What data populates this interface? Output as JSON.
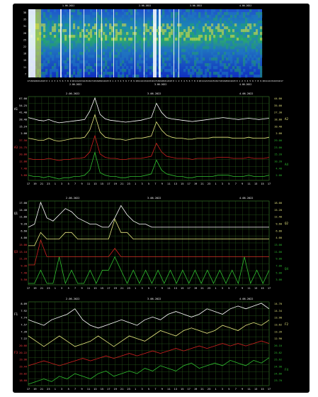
{
  "chart_data": [
    {
      "type": "heatmap",
      "title": "",
      "y_ticks": [
        "38",
        "35",
        "31",
        "28",
        "25",
        "22",
        "18",
        "15",
        "11",
        "7"
      ],
      "top_dates": [
        "1.06.2022",
        "2.06.2022",
        "3.06.2022",
        "4.06.2022"
      ],
      "x_hours": [
        "17",
        "18",
        "19",
        "20",
        "21",
        "22",
        "23",
        "0",
        "1",
        "2",
        "3",
        "4",
        "5",
        "6",
        "7",
        "8",
        "9",
        "10",
        "11",
        "12",
        "13",
        "14",
        "15",
        "16",
        "17",
        "18",
        "19",
        "20",
        "21",
        "22",
        "23",
        "0",
        "1",
        "2",
        "3",
        "4",
        "5",
        "6",
        "7",
        "8",
        "9",
        "10",
        "11",
        "12",
        "13",
        "14",
        "15",
        "16",
        "17",
        "18",
        "19",
        "20",
        "21",
        "22",
        "23",
        "0",
        "1",
        "2",
        "3",
        "4",
        "5",
        "6",
        "7",
        "8",
        "9",
        "10",
        "11",
        "12",
        "13",
        "14",
        "15",
        "16",
        "17",
        "18",
        "19",
        "20",
        "21",
        "22",
        "23",
        "0",
        "1",
        "2",
        "3",
        "4",
        "5",
        "6",
        "7",
        "8",
        "9",
        "10",
        "11",
        "12",
        "13",
        "14",
        "15",
        "16",
        "17"
      ],
      "bottom_dates": [
        "2.06.2022",
        "3.06.2022",
        "4.06.2022"
      ],
      "colors": {
        "low": "#1030c0",
        "mid": "#20a070",
        "high": "#e0e040",
        "peak": "#ffffff"
      }
    },
    {
      "type": "line",
      "panel": "A",
      "series_labels_left": [
        "A1",
        "A3"
      ],
      "series_labels_right": [
        "A2",
        "A4"
      ],
      "left_ticks": [
        "67.00",
        "54.25",
        "41.40",
        "28.40",
        "15.24",
        "2.00",
        "37.50",
        "25.75",
        "20.00",
        "12.00",
        "7.40",
        "3.60"
      ],
      "right_ticks": [
        "44.00",
        "35.00",
        "27.30",
        "18.80",
        "10.40",
        "2.00",
        "29.00",
        "23.00",
        "15.20",
        "10.20",
        "4.40",
        "2.00"
      ],
      "dates": [
        "2.06.2022",
        "3.06.2022",
        "4.06.2022"
      ],
      "x_ticks": [
        "17",
        "19",
        "21",
        "23",
        "1",
        "3",
        "5",
        "7",
        "9",
        "11",
        "13",
        "15",
        "17",
        "19",
        "21",
        "23",
        "1",
        "3",
        "5",
        "7",
        "9",
        "11",
        "13",
        "15",
        "17",
        "19",
        "21",
        "23",
        "1",
        "3",
        "5",
        "7",
        "9",
        "11",
        "13",
        "15",
        "17"
      ],
      "series": [
        {
          "name": "A1",
          "color": "#ffffff",
          "values": [
            30,
            28,
            26,
            25,
            27,
            24,
            22,
            23,
            24,
            25,
            26,
            27,
            40,
            60,
            35,
            28,
            26,
            25,
            24,
            23,
            24,
            25,
            26,
            28,
            30,
            52,
            38,
            30,
            28,
            27,
            26,
            25,
            24,
            25,
            26,
            27,
            28,
            29,
            30,
            29,
            28,
            27,
            28,
            29,
            28,
            27,
            28,
            29
          ]
        },
        {
          "name": "A2",
          "color": "#e8e880",
          "values": [
            22,
            21,
            20,
            20,
            22,
            20,
            19,
            20,
            21,
            22,
            22,
            23,
            30,
            45,
            28,
            23,
            22,
            21,
            21,
            20,
            21,
            22,
            22,
            23,
            24,
            38,
            30,
            25,
            23,
            22,
            22,
            21,
            21,
            22,
            22,
            22,
            23,
            23,
            23,
            23,
            22,
            22,
            22,
            23,
            22,
            22,
            22,
            23
          ]
        },
        {
          "name": "A3",
          "color": "#d02020",
          "values": [
            14,
            13,
            13,
            13,
            14,
            13,
            12,
            13,
            13,
            14,
            14,
            15,
            20,
            35,
            18,
            15,
            14,
            14,
            13,
            13,
            14,
            14,
            14,
            15,
            16,
            28,
            20,
            16,
            15,
            14,
            14,
            14,
            13,
            14,
            14,
            14,
            14,
            15,
            15,
            15,
            14,
            14,
            14,
            15,
            14,
            14,
            14,
            15
          ]
        },
        {
          "name": "A4",
          "color": "#30c030",
          "values": [
            8,
            7,
            7,
            6,
            7,
            6,
            5,
            6,
            6,
            7,
            7,
            8,
            12,
            26,
            10,
            8,
            7,
            7,
            6,
            6,
            7,
            7,
            7,
            8,
            9,
            20,
            12,
            9,
            8,
            7,
            7,
            6,
            6,
            7,
            7,
            7,
            7,
            8,
            8,
            8,
            7,
            7,
            7,
            8,
            7,
            7,
            7,
            8
          ]
        }
      ]
    },
    {
      "type": "line",
      "panel": "Q",
      "series_labels_left": [
        "Q1",
        "Q3"
      ],
      "series_labels_right": [
        "Q2",
        "Q4"
      ],
      "left_ticks": [
        "17.00",
        "14.40",
        "11.80",
        "9.20",
        "6.60",
        "4.00",
        "15.00",
        "13.10",
        "11.20",
        "9.30",
        "7.40",
        "5.50"
      ],
      "right_ticks": [
        "18.00",
        "15.20",
        "12.40",
        "9.60",
        "6.80",
        "4.00",
        "13.00",
        "11.00",
        "9.00",
        "7.00",
        "5.00",
        "3.00"
      ],
      "dates": [
        "2.06.2022",
        "3.06.2022",
        "4.06.2022"
      ],
      "x_ticks": [
        "17",
        "19",
        "21",
        "23",
        "1",
        "3",
        "5",
        "7",
        "9",
        "11",
        "13",
        "15",
        "17",
        "19",
        "21",
        "23",
        "1",
        "3",
        "5",
        "7",
        "9",
        "11",
        "13",
        "15",
        "17",
        "19",
        "21",
        "23",
        "1",
        "3",
        "5",
        "7",
        "9",
        "11",
        "13",
        "15",
        "17"
      ],
      "series": [
        {
          "name": "Q1",
          "color": "#ffffff",
          "values": [
            6,
            7,
            14,
            9,
            8,
            10,
            12,
            11,
            9,
            8,
            7,
            7,
            6,
            6,
            9,
            13,
            10,
            8,
            7,
            7,
            6,
            6,
            6,
            6,
            6,
            6,
            6,
            6,
            6,
            6,
            6,
            6,
            6,
            6,
            6,
            6,
            6,
            6,
            6,
            6
          ]
        },
        {
          "name": "Q2",
          "color": "#e8e880",
          "values": [
            5,
            5,
            7,
            6,
            6,
            6,
            7,
            7,
            6,
            6,
            6,
            6,
            6,
            6,
            9,
            7,
            7,
            6,
            6,
            6,
            6,
            6,
            6,
            6,
            6,
            6,
            6,
            6,
            6,
            6,
            6,
            6,
            6,
            6,
            6,
            6,
            6,
            6,
            6,
            6
          ]
        },
        {
          "name": "Q3",
          "color": "#d02020",
          "values": [
            8,
            8,
            11,
            9,
            9,
            9,
            9,
            9,
            9,
            9,
            9,
            9,
            9,
            9,
            10,
            9,
            9,
            9,
            9,
            9,
            9,
            9,
            9,
            9,
            9,
            9,
            9,
            9,
            9,
            9,
            9,
            9,
            9,
            9,
            9,
            9,
            9,
            9,
            9,
            9
          ]
        },
        {
          "name": "Q4",
          "color": "#30c030",
          "values": [
            6,
            6,
            7,
            6,
            6,
            8,
            6,
            7,
            6,
            6,
            7,
            6,
            7,
            7,
            8,
            7,
            6,
            7,
            6,
            7,
            6,
            7,
            6,
            7,
            6,
            7,
            6,
            7,
            6,
            7,
            6,
            7,
            6,
            7,
            6,
            8,
            6,
            7,
            6,
            7
          ]
        }
      ]
    },
    {
      "type": "line",
      "panel": "F",
      "series_labels_left": [
        "F1",
        "F3"
      ],
      "series_labels_right": [
        "F2",
        "F4"
      ],
      "left_ticks": [
        "8.09",
        "7.92",
        "7.74",
        "7.57",
        "7.39",
        "7.22",
        "20.66",
        "20.22",
        "19.96",
        "19.44",
        "19.02",
        "18.60"
      ],
      "right_ticks": [
        "14.70",
        "14.34",
        "13.98",
        "13.62",
        "13.26",
        "12.90",
        "26.10",
        "25.82",
        "25.62",
        "24.98",
        "24.66",
        "23.70"
      ],
      "dates": [
        "2.06.2022",
        "3.06.2022",
        "4.06.2022"
      ],
      "x_ticks": [
        "17",
        "19",
        "21",
        "23",
        "1",
        "3",
        "5",
        "7",
        "9",
        "11",
        "13",
        "15",
        "17",
        "19",
        "21",
        "23",
        "1",
        "3",
        "5",
        "7",
        "9",
        "11",
        "13",
        "15",
        "17",
        "19",
        "21",
        "23",
        "1",
        "3",
        "5",
        "7",
        "9",
        "11",
        "13",
        "15",
        "17"
      ],
      "series": [
        {
          "name": "F1",
          "color": "#ffffff",
          "values": [
            7.7,
            7.65,
            7.6,
            7.7,
            7.75,
            7.8,
            7.9,
            7.7,
            7.6,
            7.55,
            7.6,
            7.65,
            7.7,
            7.65,
            7.6,
            7.7,
            7.75,
            7.7,
            7.8,
            7.85,
            7.8,
            7.75,
            7.8,
            7.9,
            7.85,
            7.8,
            7.9,
            7.95,
            7.9,
            7.95,
            8.0,
            7.9
          ]
        },
        {
          "name": "F2",
          "color": "#e8e880",
          "values": [
            13.9,
            13.8,
            13.7,
            13.8,
            13.9,
            13.8,
            13.7,
            13.75,
            13.8,
            13.9,
            13.8,
            13.7,
            13.8,
            13.9,
            13.85,
            13.8,
            13.9,
            14.0,
            13.95,
            13.9,
            14.0,
            14.05,
            14.0,
            13.95,
            14.0,
            14.1,
            14.05,
            14.0,
            14.1,
            14.15,
            14.1,
            14.2
          ]
        },
        {
          "name": "F3",
          "color": "#d02020",
          "values": [
            19.6,
            19.7,
            19.8,
            19.7,
            19.6,
            19.7,
            19.8,
            19.9,
            19.8,
            19.9,
            20.0,
            19.9,
            20.0,
            20.1,
            20.0,
            20.1,
            20.2,
            20.1,
            20.2,
            20.3,
            20.2,
            20.3,
            20.4,
            20.3,
            20.4,
            20.5,
            20.4,
            20.5,
            20.4,
            20.5,
            20.6,
            20.5
          ]
        },
        {
          "name": "F4",
          "color": "#30c030",
          "values": [
            24.8,
            24.9,
            25.0,
            24.9,
            25.1,
            25.0,
            25.2,
            25.1,
            25.0,
            25.2,
            25.3,
            25.1,
            25.2,
            25.3,
            25.2,
            25.4,
            25.3,
            25.5,
            25.4,
            25.3,
            25.5,
            25.6,
            25.4,
            25.5,
            25.6,
            25.5,
            25.7,
            25.6,
            25.5,
            25.7,
            25.6,
            25.8
          ]
        }
      ]
    }
  ]
}
